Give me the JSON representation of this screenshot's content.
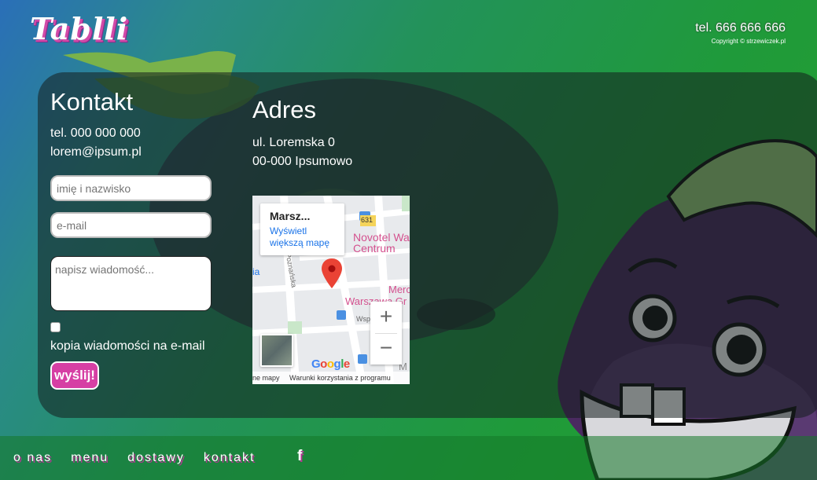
{
  "brand": {
    "logo": "Tablli"
  },
  "header": {
    "tel": "tel. 666 666 666",
    "copyright": "Copyright © strzewiczek.pl"
  },
  "kontakt": {
    "title": "Kontakt",
    "tel": "tel. 000 000 000",
    "email": "lorem@ipsum.pl",
    "name_placeholder": "imię i nazwisko",
    "email_placeholder": "e-mail",
    "message_placeholder": "napisz wiadomość...",
    "copy_label": "kopia wiadomości na e-mail",
    "send_label": "wyślij!"
  },
  "adres": {
    "title": "Adres",
    "street": "ul. Loremska 0",
    "city": "00-000 Ipsumowo"
  },
  "map": {
    "card_title": "Marsz...",
    "card_link_1": "Wyświetl",
    "card_link_2": "większą mapę",
    "label_novotel": "Novotel Wa",
    "label_centrum": "Centrum",
    "label_warszawa": "Warszawa Gr",
    "label_merc": "Merc",
    "label_poz": "Poznańska",
    "label_wsp": "Wsp",
    "label_631": "631",
    "label_m": "M",
    "label_ia": "ia",
    "zoom_in": "+",
    "zoom_out": "−",
    "google": "Google",
    "footer_1": "ne mapy",
    "footer_2": "Warunki korzystania z programu",
    "accent": "#1a73e8",
    "pin_color": "#ea4335"
  },
  "nav": {
    "items": [
      {
        "label": "o nas"
      },
      {
        "label": "menu"
      },
      {
        "label": "dostawy"
      },
      {
        "label": "kontakt"
      }
    ],
    "facebook": "f"
  },
  "colors": {
    "accent": "#d63fa4",
    "panel": "#1e2c2c"
  }
}
